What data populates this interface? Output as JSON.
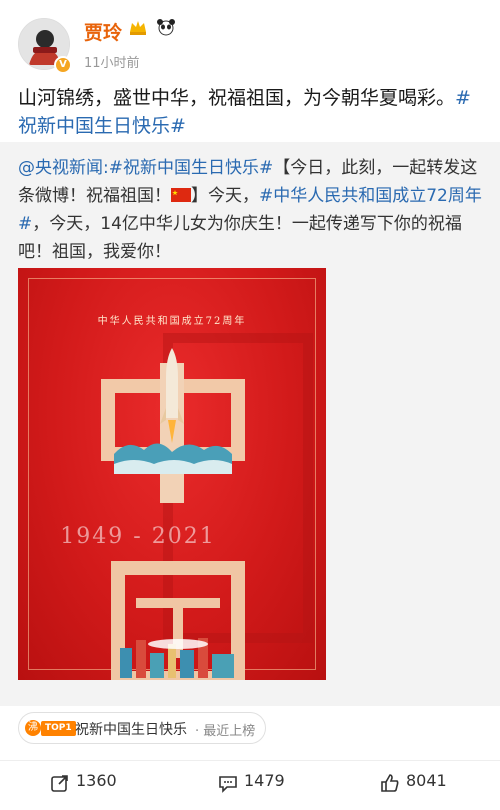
{
  "header": {
    "username": "贾玲",
    "time": "11小时前",
    "badge_icon": "crown-icon",
    "extra_icon": "panda-icon"
  },
  "post": {
    "text_main": "山河锦绣，盛世中华，祝福祖国，为今朝华夏喝彩。",
    "hashtag": "#祝新中国生日快乐#"
  },
  "repost": {
    "source": "@央视新闻",
    "hashtag1": ":#祝新中国生日快乐#",
    "text1": "【今日，此刻，一起转发这条微博！祝福祖国！",
    "text2": "】今天，",
    "hashtag2": "#中华人民共和国成立72周年#",
    "text3": "，今天，14亿中华儿女为你庆生！一起传递写下你的祝福吧！祖国，我爱你！",
    "poster": {
      "caption": "中华人民共和国成立72周年",
      "years": "1949 - 2021"
    }
  },
  "topic": {
    "badge": "TOP1",
    "label": "祝新中国生日快乐",
    "sub": "· 最近上榜"
  },
  "actions": {
    "reposts": "1360",
    "comments": "1479",
    "likes": "8041"
  },
  "colors": {
    "username": "#e8630a",
    "link": "#2a6ab1",
    "poster_red": "#d21a1a"
  }
}
